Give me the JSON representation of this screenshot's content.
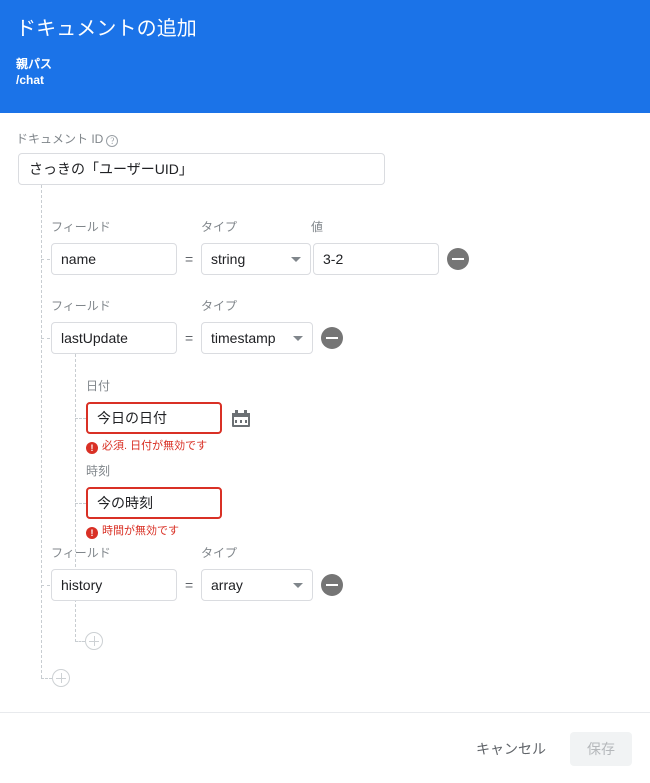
{
  "header": {
    "title": "ドキュメントの追加",
    "parent_path_label": "親パス",
    "parent_path_value": "/chat",
    "background_color": "#1b73e8"
  },
  "document_id": {
    "label": "ドキュメント ID",
    "help_icon": "help-circle-icon",
    "value": "さっきの「ユーザーUID」"
  },
  "column_labels": {
    "field": "フィールド",
    "type": "タイプ",
    "value": "値",
    "date": "日付",
    "time": "時刻"
  },
  "fields": [
    {
      "field_label": "フィールド",
      "field_name": "name",
      "equals": "=",
      "type_label": "タイプ",
      "type_value": "string",
      "value_label": "値",
      "value": "3-2",
      "remove_icon": "minus-circle-icon"
    },
    {
      "field_label": "フィールド",
      "field_name": "lastUpdate",
      "equals": "=",
      "type_label": "タイプ",
      "type_value": "timestamp",
      "remove_icon": "minus-circle-icon",
      "children": {
        "date": {
          "label": "日付",
          "value": "今日の日付",
          "calendar_icon": "calendar-icon",
          "error": "必須. 日付が無効です",
          "error_icon": "error-circle-icon"
        },
        "time": {
          "label": "時刻",
          "value": "今の時刻",
          "error": "時間が無効です",
          "error_icon": "error-circle-icon"
        }
      }
    },
    {
      "field_label": "フィールド",
      "field_name": "history",
      "equals": "=",
      "type_label": "タイプ",
      "type_value": "array",
      "remove_icon": "minus-circle-icon"
    }
  ],
  "add_buttons": {
    "nested_add_icon": "plus-circle-icon",
    "root_add_icon": "plus-circle-icon"
  },
  "footer": {
    "cancel_label": "キャンセル",
    "save_label": "保存",
    "save_disabled": true
  },
  "colors": {
    "accent": "#1b73e8",
    "error": "#d93025",
    "muted_text": "#80868b",
    "border": "#dadce0"
  }
}
